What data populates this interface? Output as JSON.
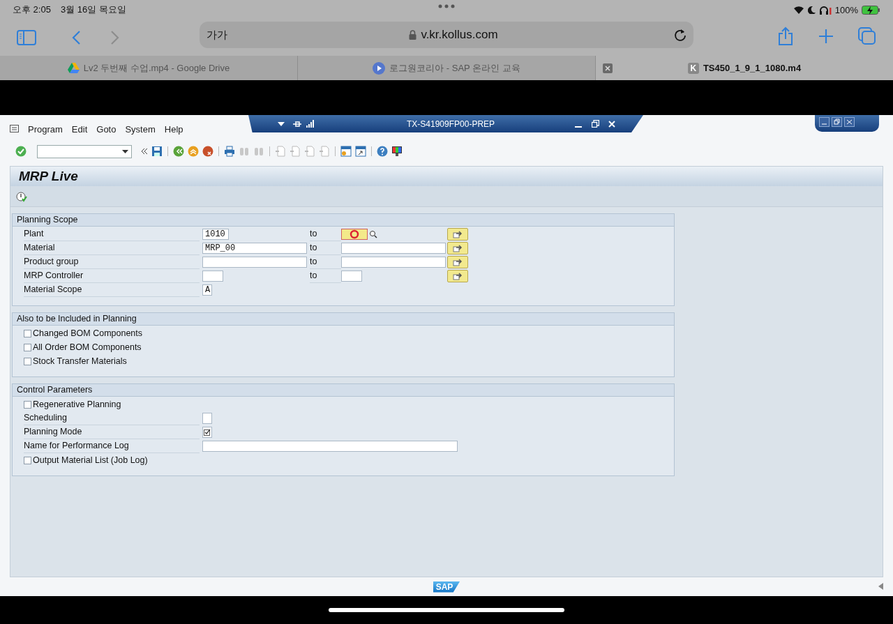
{
  "status_bar": {
    "time": "오후 2:05",
    "date": "3월 16일 목요일",
    "battery": "100%"
  },
  "browser": {
    "address": {
      "text_size": "가가",
      "url": "v.kr.kollus.com"
    },
    "tabs": [
      {
        "title": "Lv2 두번째 수업.mp4 - Google Drive",
        "selected": false
      },
      {
        "title": "로그원코리아 - SAP 온라인 교육",
        "selected": false
      },
      {
        "title": "TS450_1_9_1_1080.m4",
        "favicon": "K",
        "selected": true
      }
    ]
  },
  "sap": {
    "menu": [
      "Program",
      "Edit",
      "Goto",
      "System",
      "Help"
    ],
    "system_title": "TX-S41909FP00-PREP",
    "screen_title": "MRP Live",
    "sections": [
      {
        "title": "Planning Scope",
        "rows": [
          {
            "kind": "range",
            "label": "Plant",
            "from": {
              "kind": "short",
              "value": "1010"
            },
            "to_label": "to",
            "to": {
              "kind": "short",
              "focused": true
            }
          },
          {
            "kind": "range",
            "label": "Material",
            "from": {
              "kind": "long",
              "value": "MRP_00"
            },
            "to_label": "to",
            "to": {
              "kind": "long",
              "focused": false
            }
          },
          {
            "kind": "range",
            "label": "Product group",
            "from": {
              "kind": "long"
            },
            "to_label": "to",
            "to": {
              "kind": "long",
              "focused": false
            }
          },
          {
            "kind": "range",
            "label": "MRP Controller",
            "from": {
              "kind": "tiny"
            },
            "to_label": "to",
            "to": {
              "kind": "tiny",
              "focused": false
            }
          },
          {
            "kind": "single",
            "label": "Material Scope",
            "field": {
              "kind": "char",
              "value": "A"
            }
          }
        ]
      },
      {
        "title": "Also to be Included in Planning",
        "rows": [
          {
            "kind": "checkbox",
            "label": "Changed BOM Components",
            "checked": false
          },
          {
            "kind": "checkbox",
            "label": "All Order BOM Components",
            "checked": false
          },
          {
            "kind": "checkbox",
            "label": "Stock Transfer Materials",
            "checked": false
          }
        ]
      },
      {
        "title": "Control Parameters",
        "rows": [
          {
            "kind": "checkbox",
            "label": "Regenerative Planning",
            "checked": false
          },
          {
            "kind": "flag",
            "label": "Scheduling",
            "checked": false
          },
          {
            "kind": "flag",
            "label": "Planning Mode",
            "checked": true
          },
          {
            "kind": "single",
            "label": "Name for Performance Log",
            "field": {
              "kind": "wide"
            }
          },
          {
            "kind": "checkbox",
            "label": "Output Material List (Job Log)",
            "checked": false
          }
        ]
      }
    ],
    "logo": "SAP"
  }
}
